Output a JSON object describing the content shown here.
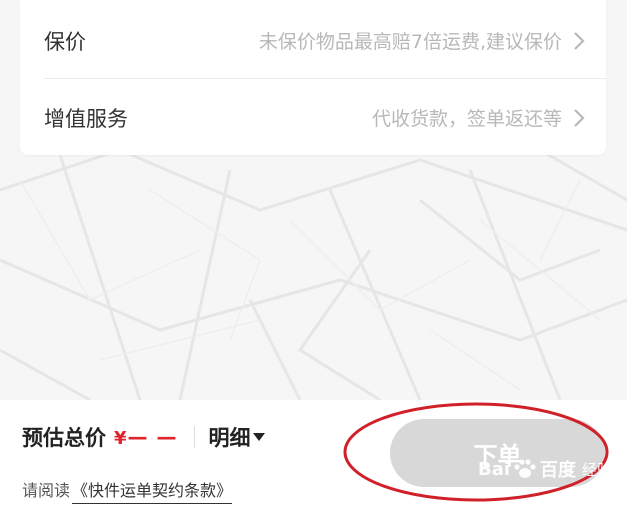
{
  "options": {
    "insurance": {
      "label": "保价",
      "value": "未保价物品最高赔7倍运费,建议保价"
    },
    "value_added_services": {
      "label": "增值服务",
      "value": "代收货款，签单返还等"
    }
  },
  "footer": {
    "estimate_label": "预估总价",
    "price_symbol": "¥",
    "price_value": "— —",
    "detail_label": "明细",
    "terms_prefix": "请阅读",
    "terms_link": "《快件运单契约条款》",
    "order_button": "下单"
  },
  "watermark": {
    "brand_left": "Bai",
    "brand_right": "百度",
    "suffix": "经验"
  },
  "colors": {
    "accent_red": "#e0242b",
    "highlight_circle": "#d0202a",
    "button_disabled": "#d8d8d8"
  },
  "icons": {
    "row_arrow": "chevron-right-icon",
    "detail_arrow": "caret-down-icon",
    "watermark": "paw-icon"
  }
}
